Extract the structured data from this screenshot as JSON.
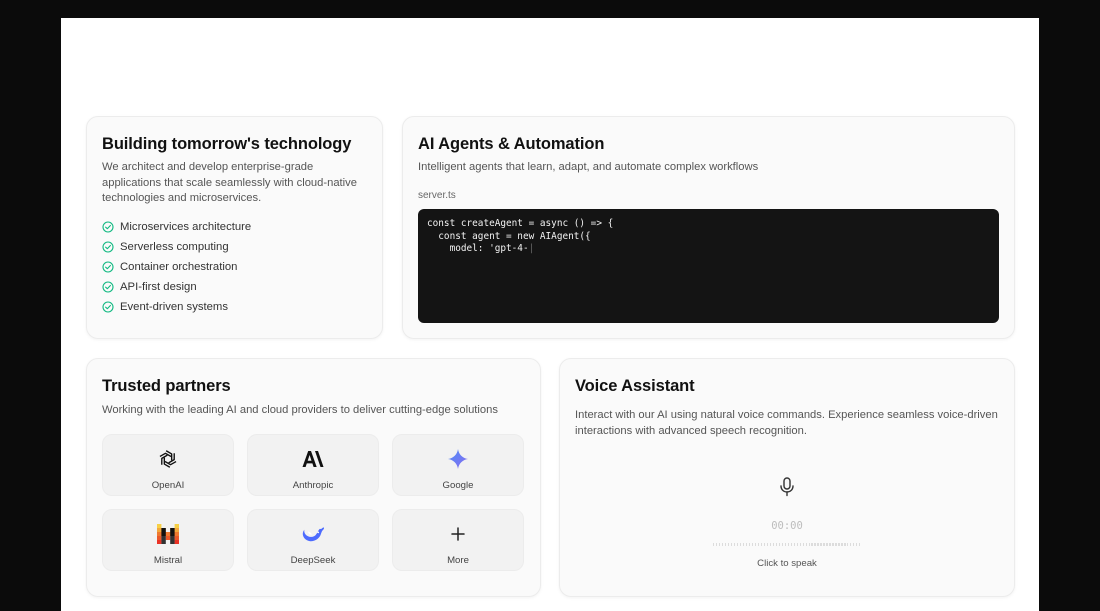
{
  "build_card": {
    "title": "Building tomorrow's technology",
    "description": "We architect and develop enterprise-grade applications that scale seamlessly with cloud-native technologies and microservices.",
    "features": [
      "Microservices architecture",
      "Serverless computing",
      "Container orchestration",
      "API-first design",
      "Event-driven systems"
    ],
    "check_icon": "check-circle-icon",
    "accent_color": "#10b981"
  },
  "agents_card": {
    "title": "AI Agents & Automation",
    "description": "Intelligent agents that learn, adapt, and automate complex workflows",
    "filename": "server.ts",
    "code_lines": [
      "const createAgent = async () => {",
      "  const agent = new AIAgent({",
      "    model: 'gpt-4-"
    ],
    "code_background": "#141414"
  },
  "partners_card": {
    "title": "Trusted partners",
    "description": "Working with the leading AI and cloud providers to deliver cutting-edge solutions",
    "partners": [
      {
        "label": "OpenAI",
        "icon": "openai-logo-icon"
      },
      {
        "label": "Anthropic",
        "icon": "anthropic-logo-icon"
      },
      {
        "label": "Google",
        "icon": "google-gemini-icon"
      },
      {
        "label": "Mistral",
        "icon": "mistral-logo-icon"
      },
      {
        "label": "DeepSeek",
        "icon": "deepseek-whale-icon"
      },
      {
        "label": "More",
        "icon": "plus-icon"
      }
    ]
  },
  "voice_card": {
    "title": "Voice Assistant",
    "description": "Interact with our AI using natural voice commands. Experience seamless voice-driven interactions with advanced speech recognition.",
    "timer": "00:00",
    "cta": "Click to speak",
    "mic_icon": "microphone-icon"
  }
}
